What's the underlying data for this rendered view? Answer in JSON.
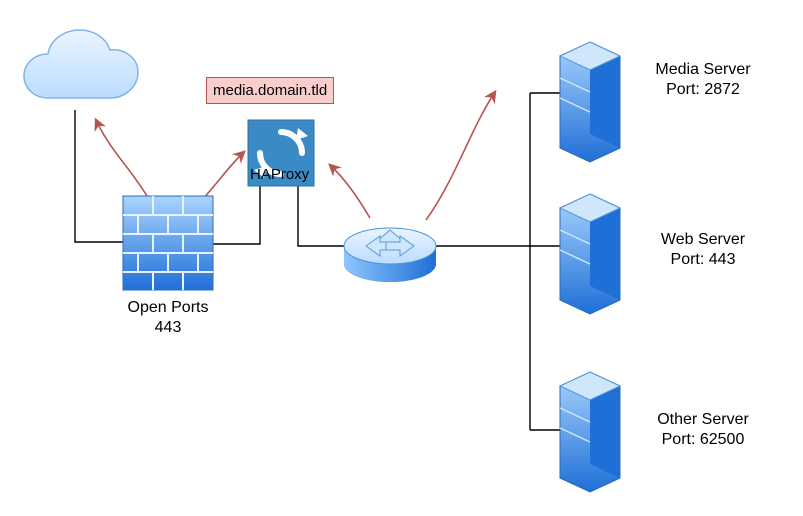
{
  "domain_box": "media.domain.tld",
  "haproxy": "HAProxy",
  "firewall": {
    "line1": "Open Ports",
    "line2": "443"
  },
  "servers": {
    "media": {
      "name": "Media Server",
      "port": "Port: 2872"
    },
    "web": {
      "name": "Web Server",
      "port": "Port: 443"
    },
    "other": {
      "name": "Other Server",
      "port": "Port: 62500"
    }
  }
}
